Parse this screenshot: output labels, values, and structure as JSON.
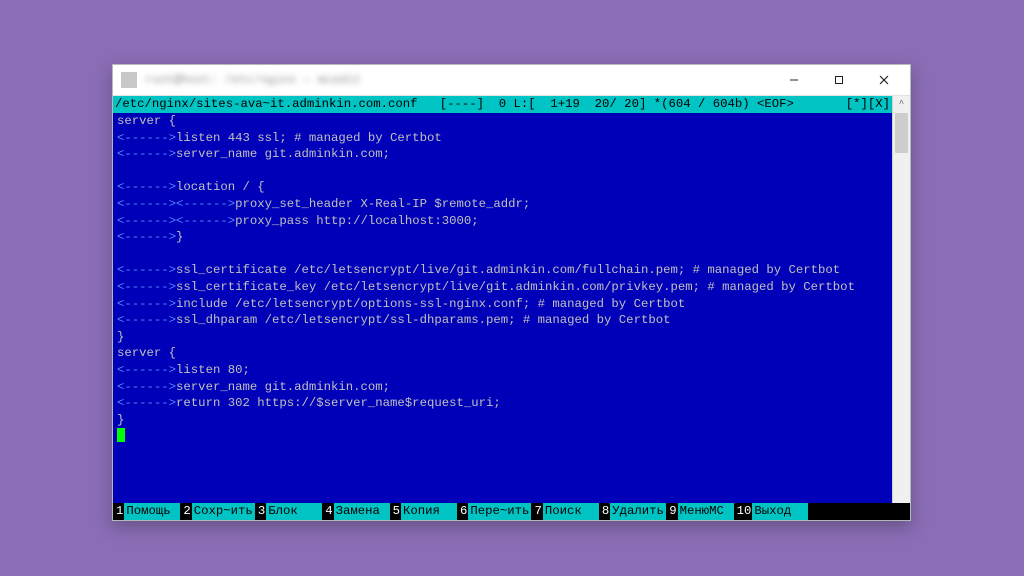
{
  "window": {
    "title": "root@host: /etc/nginx — mcedit"
  },
  "status": {
    "path": "/etc/nginx/sites-ava~it.adminkin.com.conf",
    "info": "[----]  0 L:[  1+19  20/ 20] *(604 / 604b) <EOF>",
    "flags": "[*][X]"
  },
  "code": [
    {
      "indents": [],
      "text": "server {"
    },
    {
      "indents": [
        "<------>"
      ],
      "text": "listen 443 ssl; # managed by Certbot"
    },
    {
      "indents": [
        "<------>"
      ],
      "text": "server_name git.adminkin.com;"
    },
    {
      "indents": [],
      "text": ""
    },
    {
      "indents": [
        "<------>"
      ],
      "text": "location / {"
    },
    {
      "indents": [
        "<------>",
        "<------>"
      ],
      "text": "proxy_set_header X-Real-IP $remote_addr;"
    },
    {
      "indents": [
        "<------>",
        "<------>"
      ],
      "text": "proxy_pass http://localhost:3000;"
    },
    {
      "indents": [
        "<------>"
      ],
      "text": "}"
    },
    {
      "indents": [],
      "text": ""
    },
    {
      "indents": [
        "<------>"
      ],
      "text": "ssl_certificate /etc/letsencrypt/live/git.adminkin.com/fullchain.pem; # managed by Certbot"
    },
    {
      "indents": [
        "<------>"
      ],
      "text": "ssl_certificate_key /etc/letsencrypt/live/git.adminkin.com/privkey.pem; # managed by Certbot"
    },
    {
      "indents": [
        "<------>"
      ],
      "text": "include /etc/letsencrypt/options-ssl-nginx.conf; # managed by Certbot"
    },
    {
      "indents": [
        "<------>"
      ],
      "text": "ssl_dhparam /etc/letsencrypt/ssl-dhparams.pem; # managed by Certbot"
    },
    {
      "indents": [],
      "text": "}"
    },
    {
      "indents": [],
      "text": "server {"
    },
    {
      "indents": [
        "<------>"
      ],
      "text": "listen 80;"
    },
    {
      "indents": [
        "<------>"
      ],
      "text": "server_name git.adminkin.com;"
    },
    {
      "indents": [
        "<------>"
      ],
      "text": "return 302 https://$server_name$request_uri;"
    },
    {
      "indents": [],
      "text": "}"
    }
  ],
  "fnkeys": [
    {
      "n": "1",
      "label": "Помощь"
    },
    {
      "n": "2",
      "label": "Сохр~ить"
    },
    {
      "n": "3",
      "label": "Блок"
    },
    {
      "n": "4",
      "label": "Замена"
    },
    {
      "n": "5",
      "label": "Копия"
    },
    {
      "n": "6",
      "label": "Пере~ить"
    },
    {
      "n": "7",
      "label": "Поиск"
    },
    {
      "n": "8",
      "label": "Удалить"
    },
    {
      "n": "9",
      "label": "МенюMC"
    },
    {
      "n": "10",
      "label": "Выход"
    }
  ]
}
